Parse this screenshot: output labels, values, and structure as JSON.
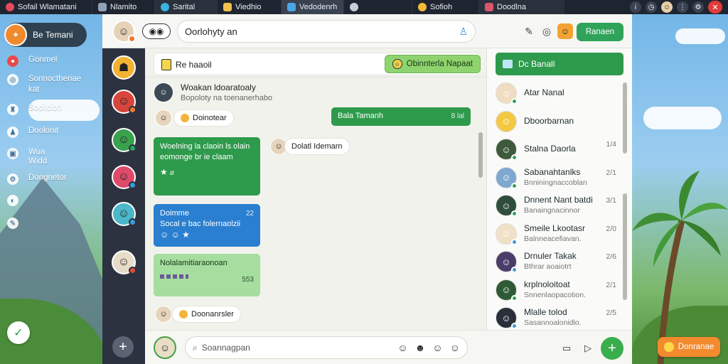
{
  "topbar": {
    "tabs": [
      {
        "label": "Sofail Wlamatani",
        "icon": "heart-app-icon",
        "color": "#e24b5a"
      },
      {
        "label": "Nlamito",
        "icon": "hash-icon",
        "color": "#8fa2b8"
      },
      {
        "label": "Sarital",
        "icon": "globe-icon",
        "color": "#39b3e0"
      },
      {
        "label": "Viedhio",
        "icon": "yellow-doc-icon",
        "color": "#f2c14e"
      },
      {
        "label": "Vedodenrh",
        "icon": "chat-icon",
        "color": "#4aa8e8"
      },
      {
        "label": "",
        "icon": "compass-icon",
        "color": "#c7cdd6"
      },
      {
        "label": "Sofioh",
        "icon": "smiley-icon",
        "color": "#f5b93a"
      },
      {
        "label": "Doodlna",
        "icon": "grid-icon",
        "color": "#d9566b"
      }
    ],
    "active_tab_index": 4
  },
  "sidebar": {
    "brand": {
      "label": "Be Temani"
    },
    "items": [
      {
        "label": "Gonmel",
        "icon": "bell-icon"
      },
      {
        "label": "Sonnoctheriae\nkat",
        "icon": "chat-bubble-icon"
      },
      {
        "label": "Socitcion",
        "icon": "people-icon"
      },
      {
        "label": "Doolonit",
        "icon": "person-icon"
      },
      {
        "label": "Wua\nWidd",
        "icon": "image-icon"
      },
      {
        "label": "Dongnetor",
        "icon": "gear-icon"
      },
      {
        "label": "",
        "icon": "shield-icon"
      },
      {
        "label": "",
        "icon": "pin-icon"
      }
    ]
  },
  "header": {
    "search_text": "Oorlohyty an",
    "emoji_label": "◉◉",
    "action_button": "Ranaen"
  },
  "chat": {
    "room_title": "Re haaoil",
    "join_button": "Obinnterla Napaat",
    "messages": {
      "m1_title": "Woakan ldoaratoaly",
      "m1_sub": "Bopoloty na toenanerhabo",
      "m2_chip": "Doinotear",
      "m3_bubble": "Bala Tamanh",
      "m3_meta": "8 lal",
      "m4_chip": "Dolatl Idemarn",
      "m5_line1": "Woelning la claoin ls olain",
      "m5_line2": "eomonge br ie claam",
      "m5_meta": "ø",
      "m6_title": "Doimme",
      "m6_meta": "22",
      "m6_line2": "Socal e bac folernaolzii",
      "m7_title": "Nolalamitiaraonoan",
      "m7_meta": "553",
      "m8_chip": "Doonanrsler"
    }
  },
  "composer": {
    "placeholder": "Soannagpan"
  },
  "contacts": {
    "header": "Dc Banall",
    "items": [
      {
        "name": "Atar Nanal",
        "sub": "",
        "time": "",
        "color": "#f0dcc0",
        "status": "#2fa35a"
      },
      {
        "name": "Dboorbarnan",
        "sub": "",
        "time": "",
        "color": "#f4c942",
        "status": ""
      },
      {
        "name": "Stalna Daorla",
        "sub": "",
        "time": "1/4",
        "color": "#3d5a3a",
        "status": "#2fa35a"
      },
      {
        "name": "Sabanahtanlks",
        "sub": "Bnniningnaccoblan",
        "time": "2/1",
        "color": "#7fa8d0",
        "status": "#2fa35a"
      },
      {
        "name": "Dnnent Nant batdi",
        "sub": "Banaingnacinnor",
        "time": "3/1",
        "color": "#2e4d3a",
        "status": "#2fa35a"
      },
      {
        "name": "Smeile Lkootasr",
        "sub": "Balnneacefiavan.",
        "time": "2/0",
        "color": "#f0e0c6",
        "status": "#3a9ad8"
      },
      {
        "name": "Drnuler Takak",
        "sub": "Bthrar aoaiotrt",
        "time": "2/6",
        "color": "#4b3d6a",
        "status": "#3a9ad8"
      },
      {
        "name": "krplnoloitoat",
        "sub": "Snnenlaopacotion.",
        "time": "2/1",
        "color": "#2f5a36",
        "status": "#2fa35a"
      },
      {
        "name": "Mlalle tolod",
        "sub": "Sasannoalonidlo.",
        "time": "2/5",
        "color": "#2a2f3a",
        "status": "#3a9ad8"
      }
    ]
  },
  "footer_right": {
    "label": "Donranae"
  },
  "colors": {
    "accent_green": "#2e9a4c",
    "accent_blue": "#2a7fd0",
    "accent_orange": "#f28a2e",
    "danger": "#e03b3b"
  }
}
